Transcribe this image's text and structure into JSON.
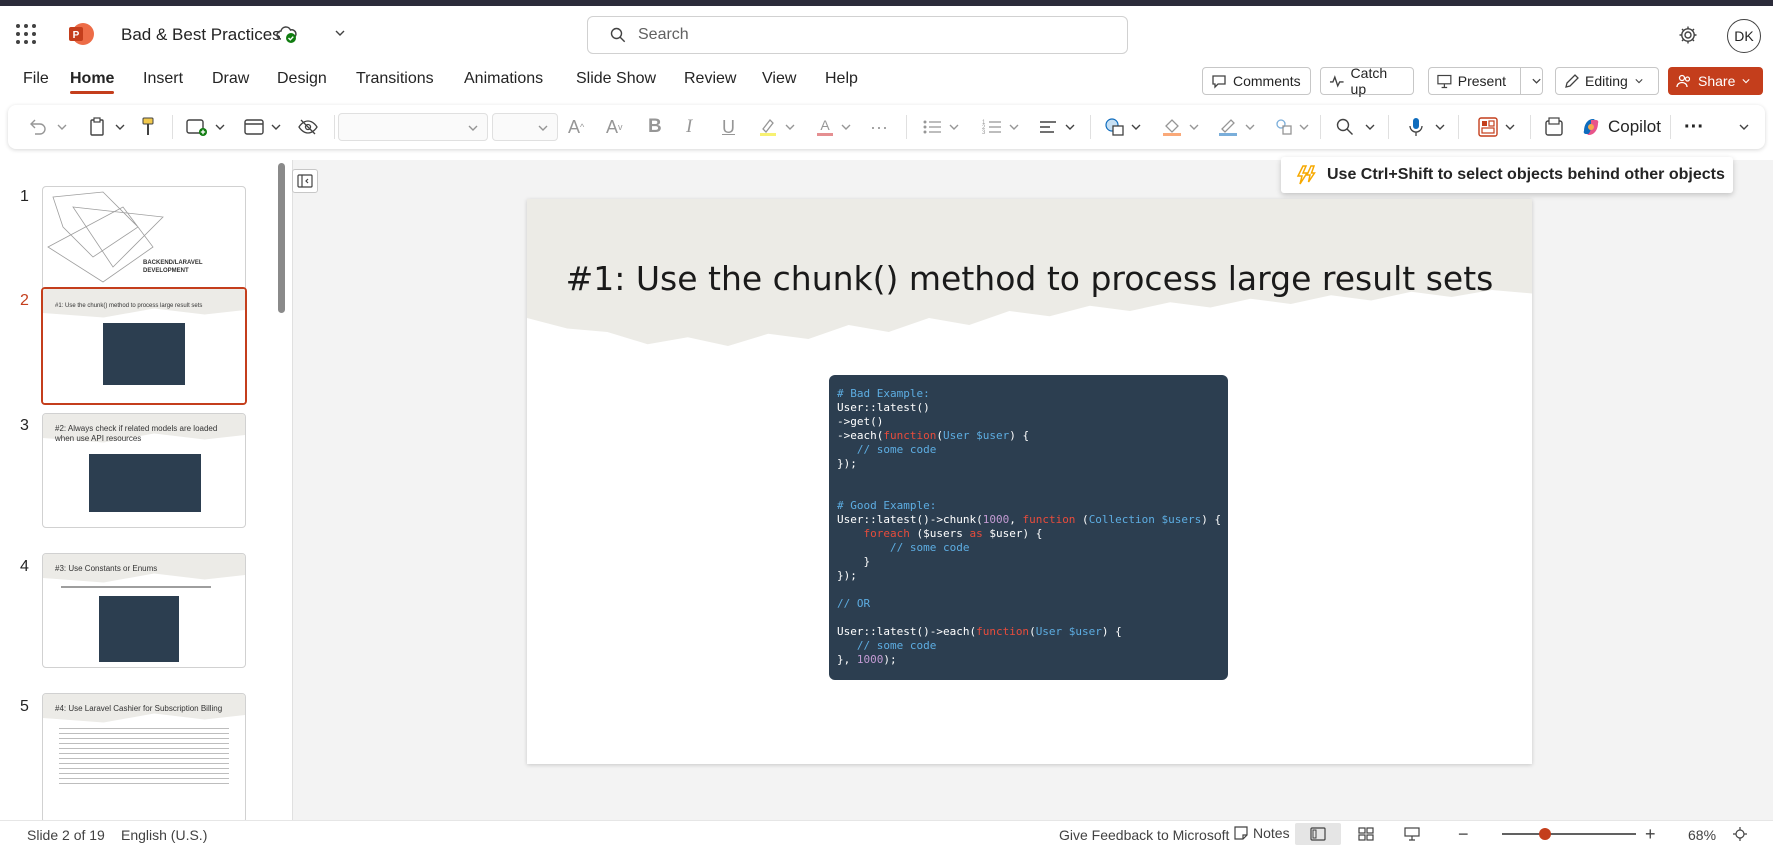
{
  "app": {
    "doc_title": "Bad & Best Practices",
    "search_placeholder": "Search",
    "user_initials": "DK"
  },
  "menu": {
    "tabs": [
      "File",
      "Home",
      "Insert",
      "Draw",
      "Design",
      "Transitions",
      "Animations",
      "Slide Show",
      "Review",
      "View",
      "Help"
    ],
    "active_tab": "Home",
    "comments_label": "Comments",
    "catchup_label": "Catch up",
    "present_label": "Present",
    "editing_label": "Editing",
    "share_label": "Share"
  },
  "ribbon": {
    "copilot_label": "Copilot"
  },
  "tooltip": {
    "text": "Use Ctrl+Shift to select objects behind other objects"
  },
  "thumbnails": [
    {
      "number": "1",
      "title": "",
      "subtitle": "BACKEND/LARAVEL DEVELOPMENT"
    },
    {
      "number": "2",
      "title": "#1: Use the chunk() method to process large result sets"
    },
    {
      "number": "3",
      "title": "#2: Always check if related models are loaded when use API resources"
    },
    {
      "number": "4",
      "title": "#3: Use Constants or Enums"
    },
    {
      "number": "5",
      "title": "#4: Use Laravel Cashier for Subscription Billing"
    }
  ],
  "slide": {
    "title": "#1: Use the chunk() method to process large result sets",
    "code": {
      "bad_comment": "# Bad Example:",
      "good_comment": "# Good Example:",
      "or_comment": "// OR"
    }
  },
  "status": {
    "slide_info": "Slide 2 of 19",
    "language": "English (U.S.)",
    "feedback": "Give Feedback to Microsoft",
    "notes": "Notes",
    "zoom": "68%"
  },
  "colors": {
    "accent": "#c43e1c",
    "code_bg": "#2c3e50",
    "slide_header": "#ecebe6"
  }
}
